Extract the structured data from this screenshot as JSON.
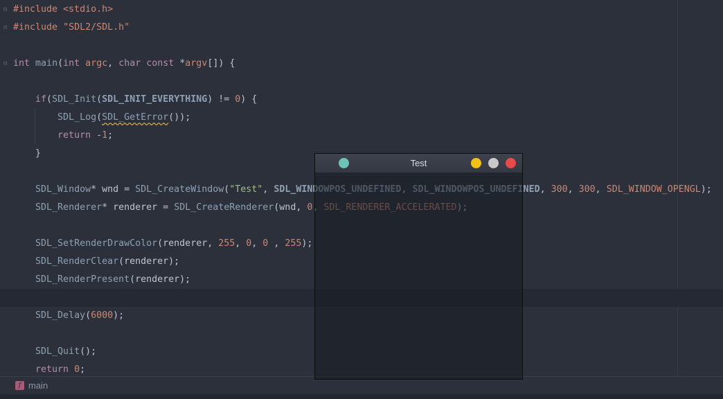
{
  "editor": {
    "lines": [
      [
        {
          "t": "#include <stdio.h>",
          "c": "pp"
        }
      ],
      [
        {
          "t": "#include ",
          "c": "pp"
        },
        {
          "t": "\"SDL2/SDL.h\"",
          "c": "pp"
        }
      ],
      [],
      [
        {
          "t": "int",
          "c": "ty"
        },
        {
          "t": " "
        },
        {
          "t": "main",
          "c": "fn"
        },
        {
          "t": "("
        },
        {
          "t": "int",
          "c": "ty"
        },
        {
          "t": " "
        },
        {
          "t": "argc",
          "c": "arg"
        },
        {
          "t": ", "
        },
        {
          "t": "char",
          "c": "ty"
        },
        {
          "t": " "
        },
        {
          "t": "const",
          "c": "kw"
        },
        {
          "t": " *"
        },
        {
          "t": "argv",
          "c": "arg"
        },
        {
          "t": "[]) {"
        }
      ],
      [],
      [
        {
          "t": "    "
        },
        {
          "t": "if",
          "c": "kw"
        },
        {
          "t": "("
        },
        {
          "t": "SDL_Init",
          "c": "fn"
        },
        {
          "t": "("
        },
        {
          "t": "SDL_INIT_EVERYTHING",
          "c": "const"
        },
        {
          "t": ") != "
        },
        {
          "t": "0",
          "c": "num"
        },
        {
          "t": ") {"
        }
      ],
      [
        {
          "t": "        "
        },
        {
          "t": "SDL_Log",
          "c": "fn"
        },
        {
          "t": "("
        },
        {
          "t": "SDL_GetError",
          "c": "fn squig"
        },
        {
          "t": "());"
        }
      ],
      [
        {
          "t": "        "
        },
        {
          "t": "return",
          "c": "kw"
        },
        {
          "t": " -"
        },
        {
          "t": "1",
          "c": "num"
        },
        {
          "t": ";"
        }
      ],
      [
        {
          "t": "    }"
        }
      ],
      [],
      [
        {
          "t": "    "
        },
        {
          "t": "SDL_Window",
          "c": "fn"
        },
        {
          "t": "* wnd = "
        },
        {
          "t": "SDL_CreateWindow",
          "c": "fn"
        },
        {
          "t": "("
        },
        {
          "t": "\"Test\"",
          "c": "str"
        },
        {
          "t": ", "
        },
        {
          "t": "SDL_WINDOWPOS_UNDEFINED",
          "c": "const"
        },
        {
          "t": ", "
        },
        {
          "t": "SDL_WINDOWPOS_UNDEFINED",
          "c": "const"
        },
        {
          "t": ", "
        },
        {
          "t": "300",
          "c": "num"
        },
        {
          "t": ", "
        },
        {
          "t": "300",
          "c": "num"
        },
        {
          "t": ", "
        },
        {
          "t": "SDL_WINDOW_OPENGL",
          "c": "enum"
        },
        {
          "t": ");"
        }
      ],
      [
        {
          "t": "    "
        },
        {
          "t": "SDL_Renderer",
          "c": "fn"
        },
        {
          "t": "* renderer = "
        },
        {
          "t": "SDL_CreateRenderer",
          "c": "fn"
        },
        {
          "t": "(wnd, "
        },
        {
          "t": "0",
          "c": "num"
        },
        {
          "t": ", "
        },
        {
          "t": "SDL_RENDERER_ACCELERATED",
          "c": "enum"
        },
        {
          "t": ");"
        }
      ],
      [],
      [
        {
          "t": "    "
        },
        {
          "t": "SDL_SetRenderDrawColor",
          "c": "fn"
        },
        {
          "t": "(renderer, "
        },
        {
          "t": "255",
          "c": "num"
        },
        {
          "t": ", "
        },
        {
          "t": "0",
          "c": "num"
        },
        {
          "t": ", "
        },
        {
          "t": "0",
          "c": "num"
        },
        {
          "t": " , "
        },
        {
          "t": "255",
          "c": "num"
        },
        {
          "t": ");"
        }
      ],
      [
        {
          "t": "    "
        },
        {
          "t": "SDL_RenderClear",
          "c": "fn"
        },
        {
          "t": "(renderer);"
        }
      ],
      [
        {
          "t": "    "
        },
        {
          "t": "SDL_RenderPresent",
          "c": "fn"
        },
        {
          "t": "(renderer);"
        }
      ],
      [],
      [
        {
          "t": "    "
        },
        {
          "t": "SDL_Delay",
          "c": "fn"
        },
        {
          "t": "("
        },
        {
          "t": "6000",
          "c": "num"
        },
        {
          "t": ");"
        }
      ],
      [],
      [
        {
          "t": "    "
        },
        {
          "t": "SDL_Quit",
          "c": "fn"
        },
        {
          "t": "();"
        }
      ],
      [
        {
          "t": "    "
        },
        {
          "t": "return",
          "c": "kw"
        },
        {
          "t": " "
        },
        {
          "t": "0",
          "c": "num"
        },
        {
          "t": ";"
        }
      ]
    ],
    "current_line": 16,
    "fold_lines": [
      0,
      1,
      3
    ]
  },
  "statusbar": {
    "symbol_icon": "function-icon",
    "symbol_icon_glyph": "f",
    "symbol": "main"
  },
  "sdl_window": {
    "title": "Test",
    "buttons": [
      "minimize",
      "maximize",
      "close"
    ]
  },
  "colors": {
    "background": "#2b303b",
    "window_close": "#e64a4a",
    "window_minimize": "#f2c21b",
    "window_maximize": "#c9c9c9",
    "window_icon": "#6cc3b8"
  }
}
